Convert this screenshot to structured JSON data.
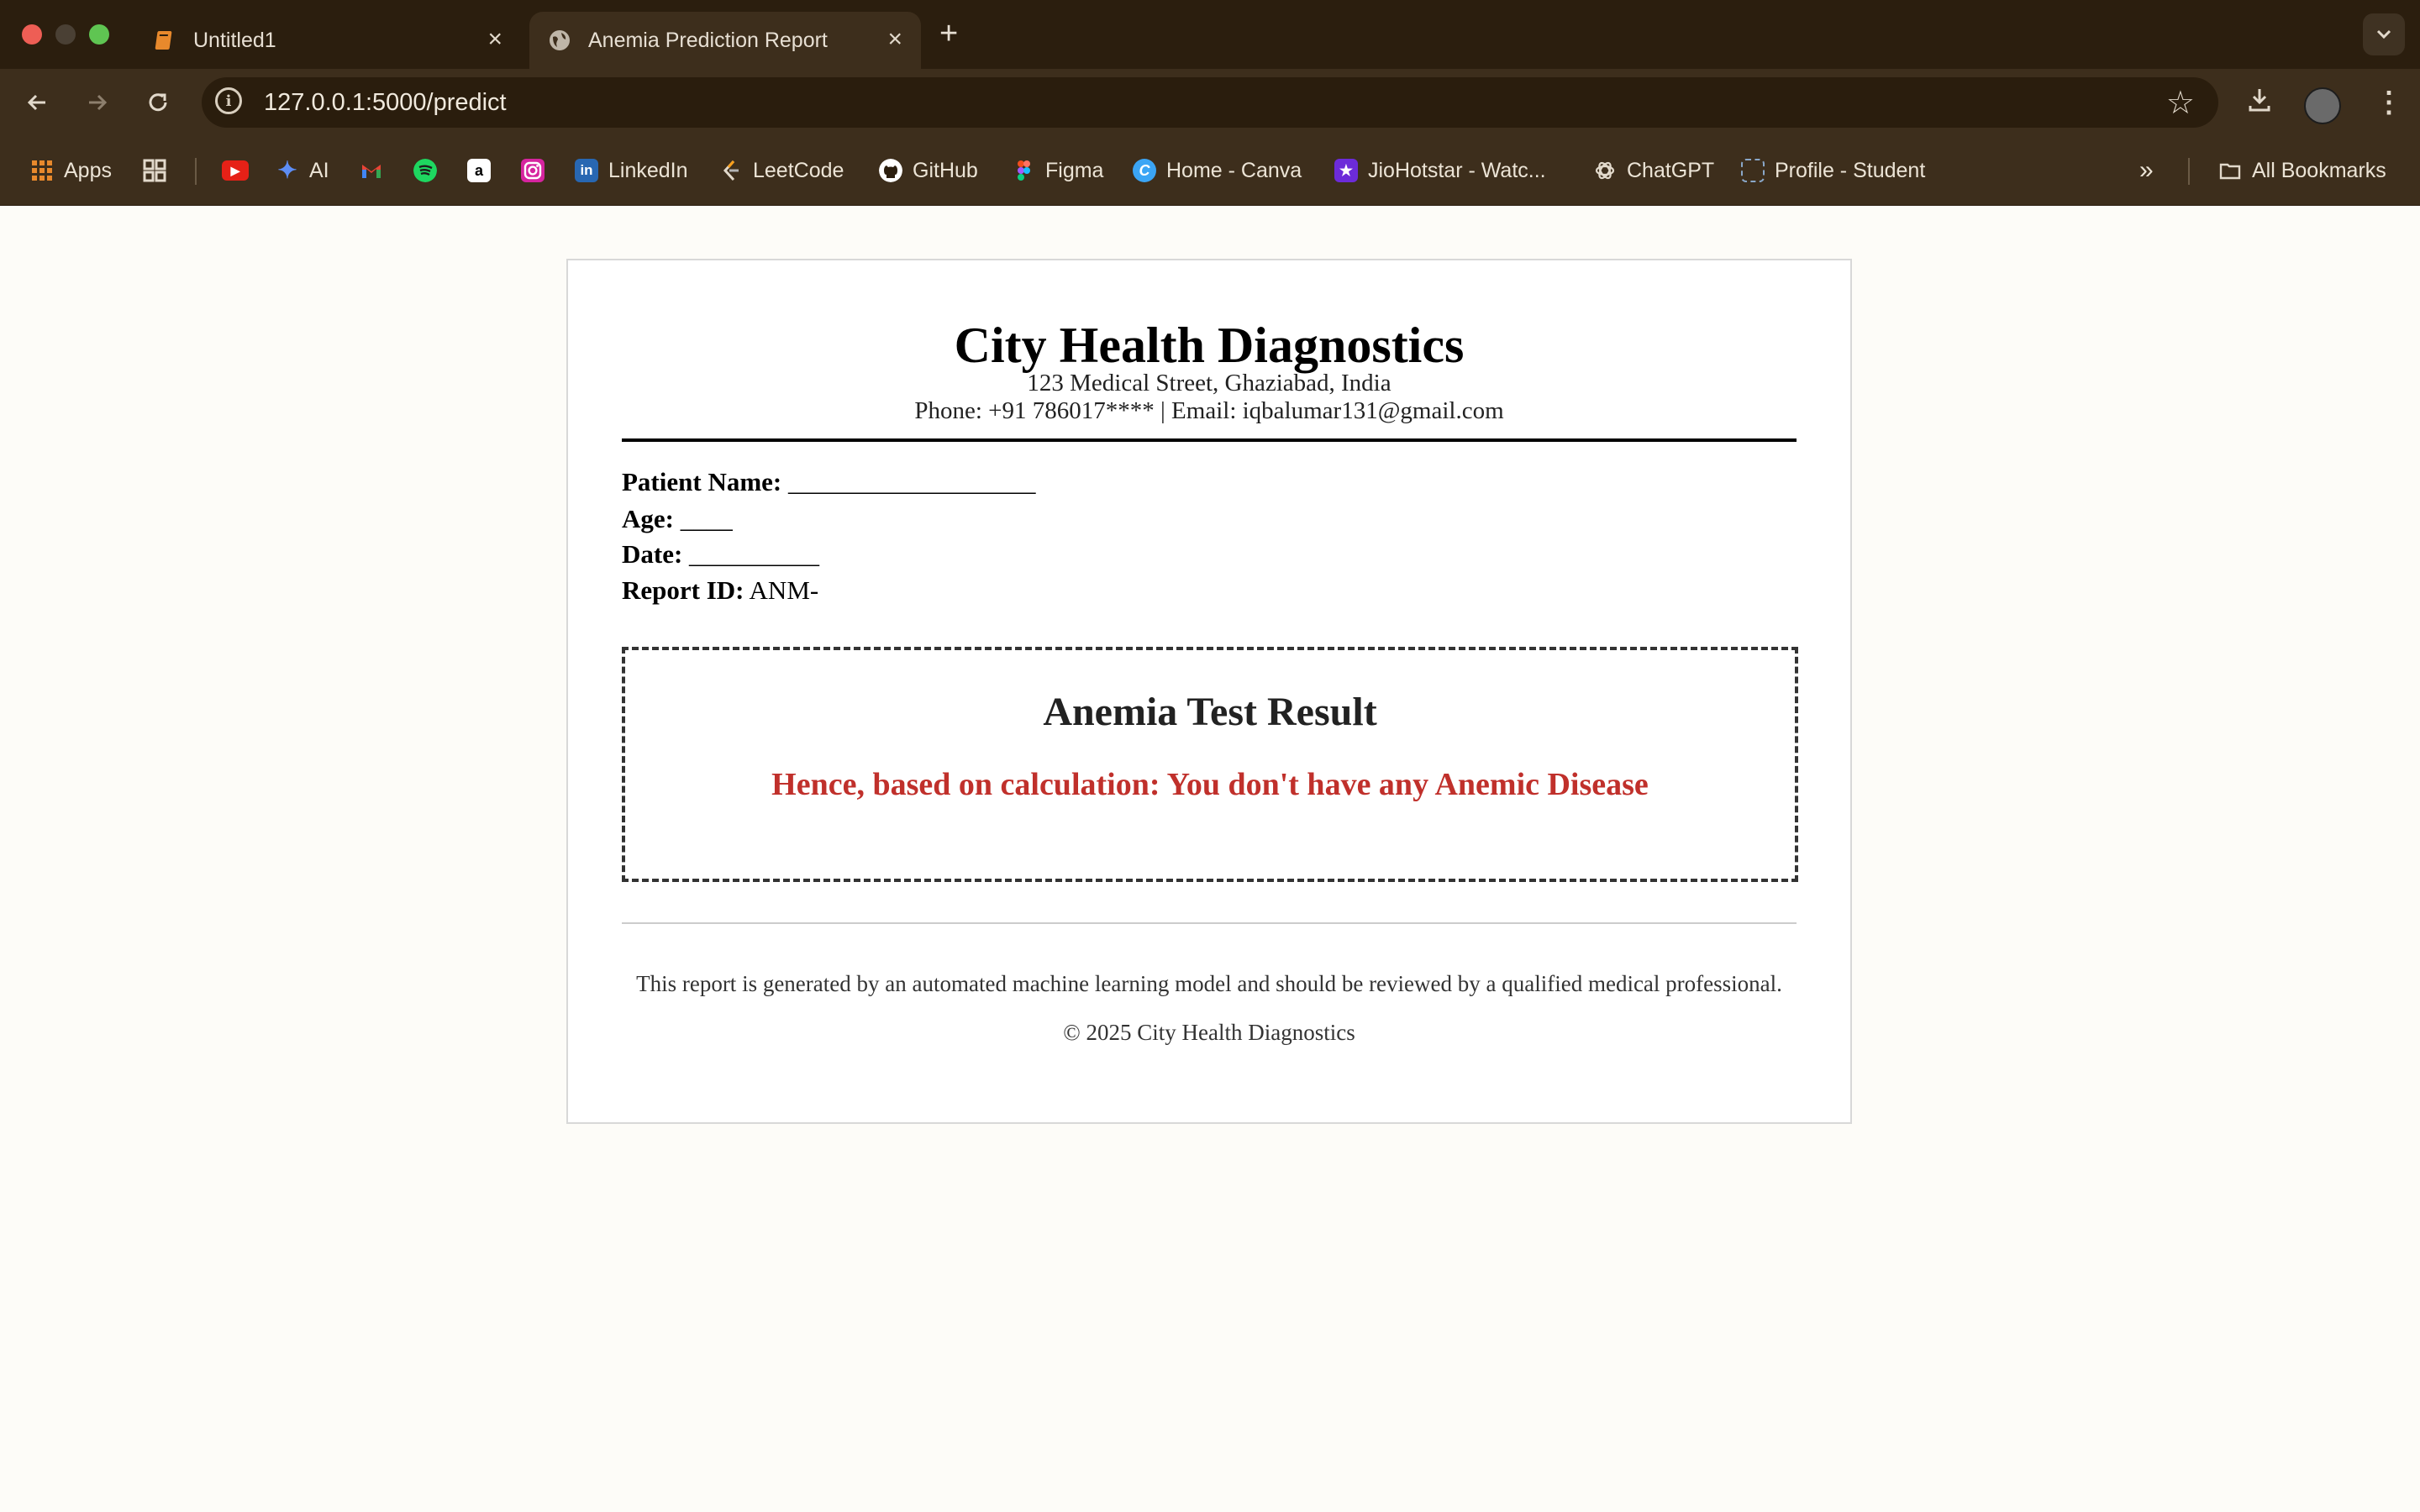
{
  "browser": {
    "tabs": [
      {
        "title": "Untitled1",
        "active": false
      },
      {
        "title": "Anemia Prediction Report",
        "active": true
      }
    ],
    "new_tab": "+",
    "url": "127.0.0.1:5000/predict",
    "bookmarks": [
      {
        "label": "Apps",
        "icon": "apps-grid-icon"
      },
      {
        "label": "",
        "icon": "tab-groups-icon"
      },
      {
        "label": "",
        "icon": "youtube-icon"
      },
      {
        "label": "AI",
        "icon": "gemini-icon"
      },
      {
        "label": "",
        "icon": "gmail-icon"
      },
      {
        "label": "",
        "icon": "spotify-icon"
      },
      {
        "label": "",
        "icon": "amazon-icon"
      },
      {
        "label": "",
        "icon": "instagram-icon"
      },
      {
        "label": "LinkedIn",
        "icon": "linkedin-icon"
      },
      {
        "label": "LeetCode",
        "icon": "leetcode-icon"
      },
      {
        "label": "GitHub",
        "icon": "github-icon"
      },
      {
        "label": "Figma",
        "icon": "figma-icon"
      },
      {
        "label": "Home - Canva",
        "icon": "canva-icon"
      },
      {
        "label": "JioHotstar - Watc...",
        "icon": "jiohotstar-icon"
      },
      {
        "label": "ChatGPT",
        "icon": "chatgpt-icon"
      },
      {
        "label": "Profile - Student",
        "icon": "profile-page-icon"
      }
    ],
    "all_bookmarks": "All Bookmarks"
  },
  "report": {
    "clinic_name": "City Health Diagnostics",
    "address": "123 Medical Street, Ghaziabad, India",
    "contact": "Phone: +91 786017**** | Email: iqbalumar131@gmail.com",
    "fields": [
      {
        "label": "Patient Name:",
        "value": "___________________"
      },
      {
        "label": "Age:",
        "value": "____"
      },
      {
        "label": "Date:",
        "value": "__________"
      },
      {
        "label": "Report ID:",
        "value": "ANM-"
      }
    ],
    "result_title": "Anemia Test Result",
    "result_text": "Hence, based on calculation: You don't have any Anemic Disease",
    "disclaimer": "This report is generated by an automated machine learning model and should be reviewed by a qualified medical professional.",
    "copyright": "© 2025 City Health Diagnostics"
  },
  "colors": {
    "chrome_dark": "#2b1e0e",
    "chrome_toolbar": "#3d2e1c",
    "page_bg": "#fdfcf8",
    "result_red": "#c0302b"
  }
}
